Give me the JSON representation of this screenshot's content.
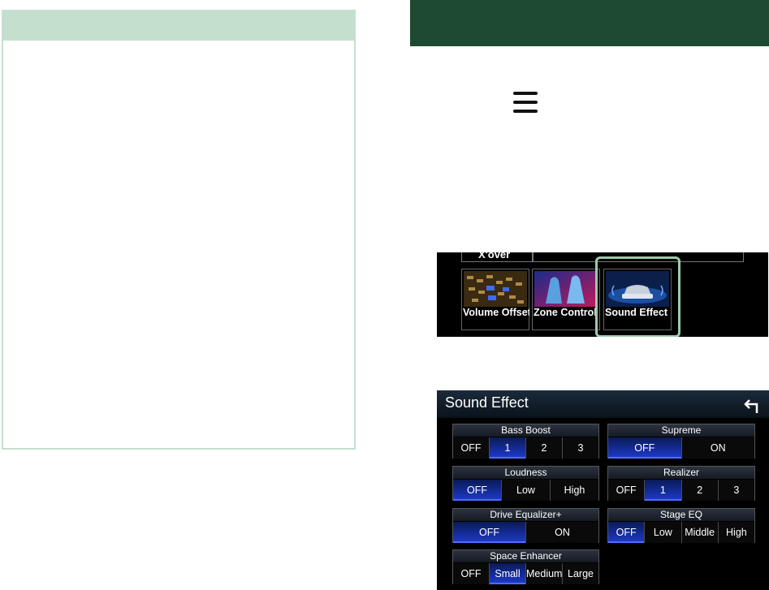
{
  "setup_tiles": {
    "top_label": "X'over",
    "items": [
      {
        "label": "Volume Offset",
        "icon": "equalizer-sliders-image"
      },
      {
        "label": "Zone Control",
        "icon": "car-seats-image"
      },
      {
        "label": "Sound Effect",
        "icon": "car-sound-image"
      }
    ]
  },
  "sound_effect": {
    "title": "Sound Effect",
    "back_icon": "return-arrow-icon",
    "groups": {
      "bass_boost": {
        "title": "Bass Boost",
        "options": [
          "OFF",
          "1",
          "2",
          "3"
        ],
        "selected": "1"
      },
      "supreme": {
        "title": "Supreme",
        "options": [
          "OFF",
          "ON"
        ],
        "selected": "OFF"
      },
      "loudness": {
        "title": "Loudness",
        "options": [
          "OFF",
          "Low",
          "High"
        ],
        "selected": "OFF"
      },
      "realizer": {
        "title": "Realizer",
        "options": [
          "OFF",
          "1",
          "2",
          "3"
        ],
        "selected": "1"
      },
      "drive_eq": {
        "title": "Drive Equalizer+",
        "options": [
          "OFF",
          "ON"
        ],
        "selected": "OFF"
      },
      "stage_eq": {
        "title": "Stage EQ",
        "options": [
          "OFF",
          "Low",
          "Middle",
          "High"
        ],
        "selected": "OFF"
      },
      "space_enhancer": {
        "title": "Space Enhancer",
        "options": [
          "OFF",
          "Small",
          "Medium",
          "Large"
        ],
        "selected": "Small"
      }
    }
  },
  "colors": {
    "header_green": "#1f4a32",
    "note_green": "#c5dfcf",
    "active_blue": "#1e3bd0"
  }
}
